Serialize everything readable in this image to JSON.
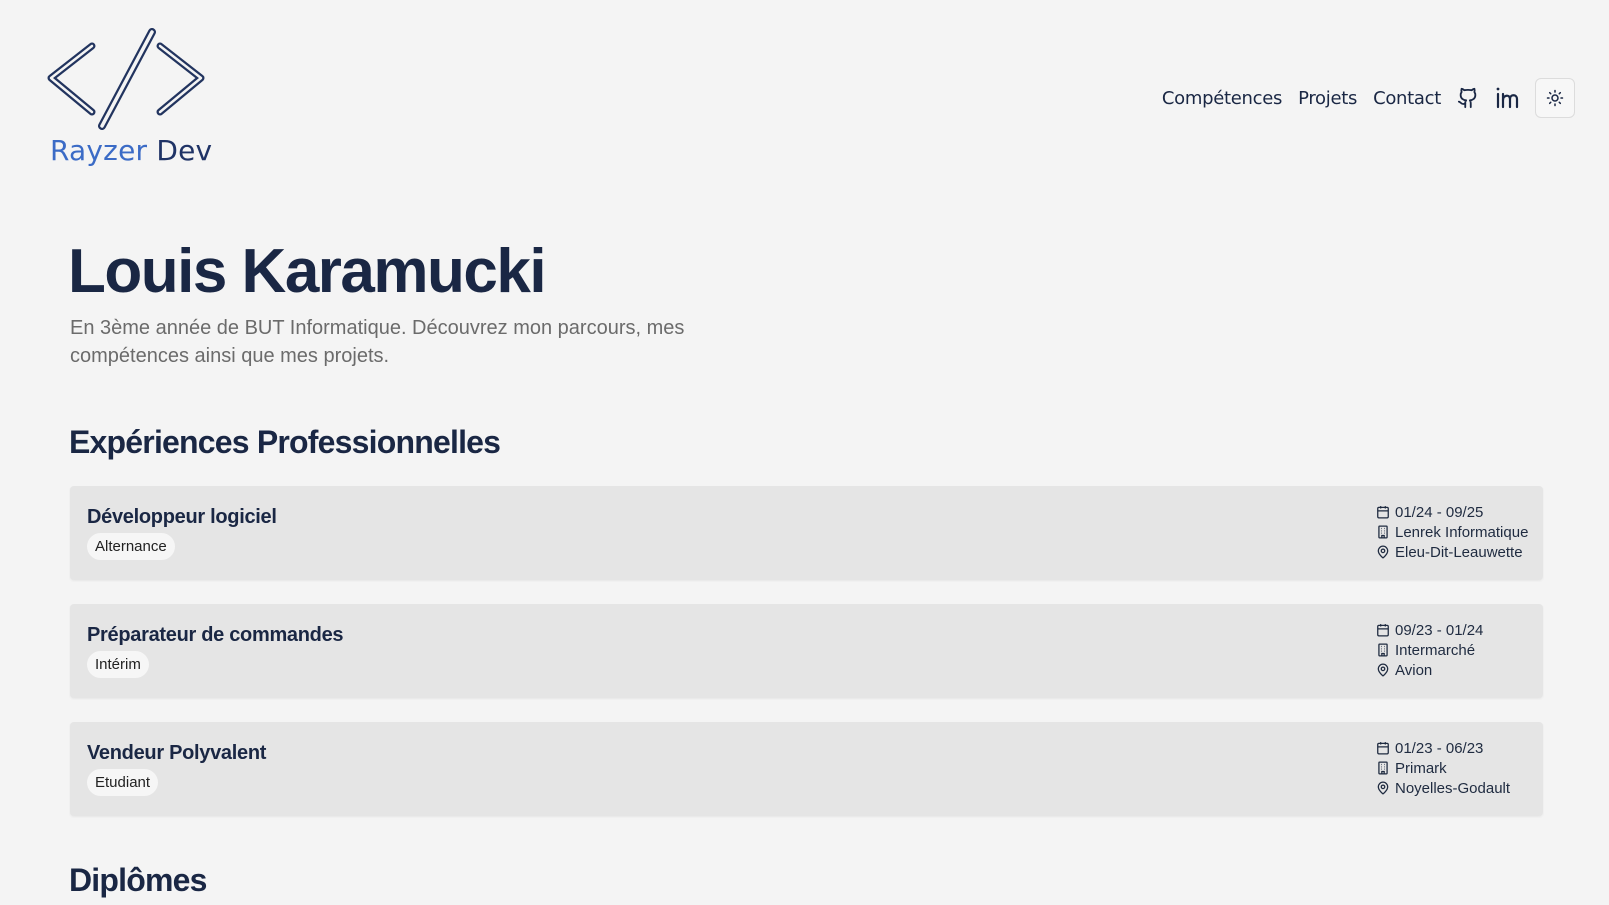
{
  "brand": {
    "part1": "Rayzer",
    "part2": "Dev"
  },
  "nav": {
    "links": [
      "Compétences",
      "Projets",
      "Contact"
    ],
    "icons": [
      "github-icon",
      "linkedin-icon",
      "sun-icon"
    ]
  },
  "hero": {
    "name": "Louis Karamucki",
    "subtitle": "En 3ème année de BUT Informatique. Découvrez mon parcours, mes compétences ainsi que mes projets."
  },
  "sections": {
    "experiences_title": "Expériences Professionnelles",
    "diplomas_title": "Diplômes"
  },
  "experiences": [
    {
      "title": "Développeur logiciel",
      "type": "Alternance",
      "dates": "01/24 - 09/25",
      "company": "Lenrek Informatique",
      "location": "Eleu-Dit-Leauwette"
    },
    {
      "title": "Préparateur de commandes",
      "type": "Intérim",
      "dates": "09/23 - 01/24",
      "company": "Intermarché",
      "location": "Avion"
    },
    {
      "title": "Vendeur Polyvalent",
      "type": "Etudiant",
      "dates": "01/23 - 06/23",
      "company": "Primark",
      "location": "Noyelles-Godault"
    }
  ],
  "colors": {
    "background": "#f4f4f4",
    "card": "#e5e5e5",
    "text": "#1a2744",
    "accent": "#3b6bc6"
  }
}
